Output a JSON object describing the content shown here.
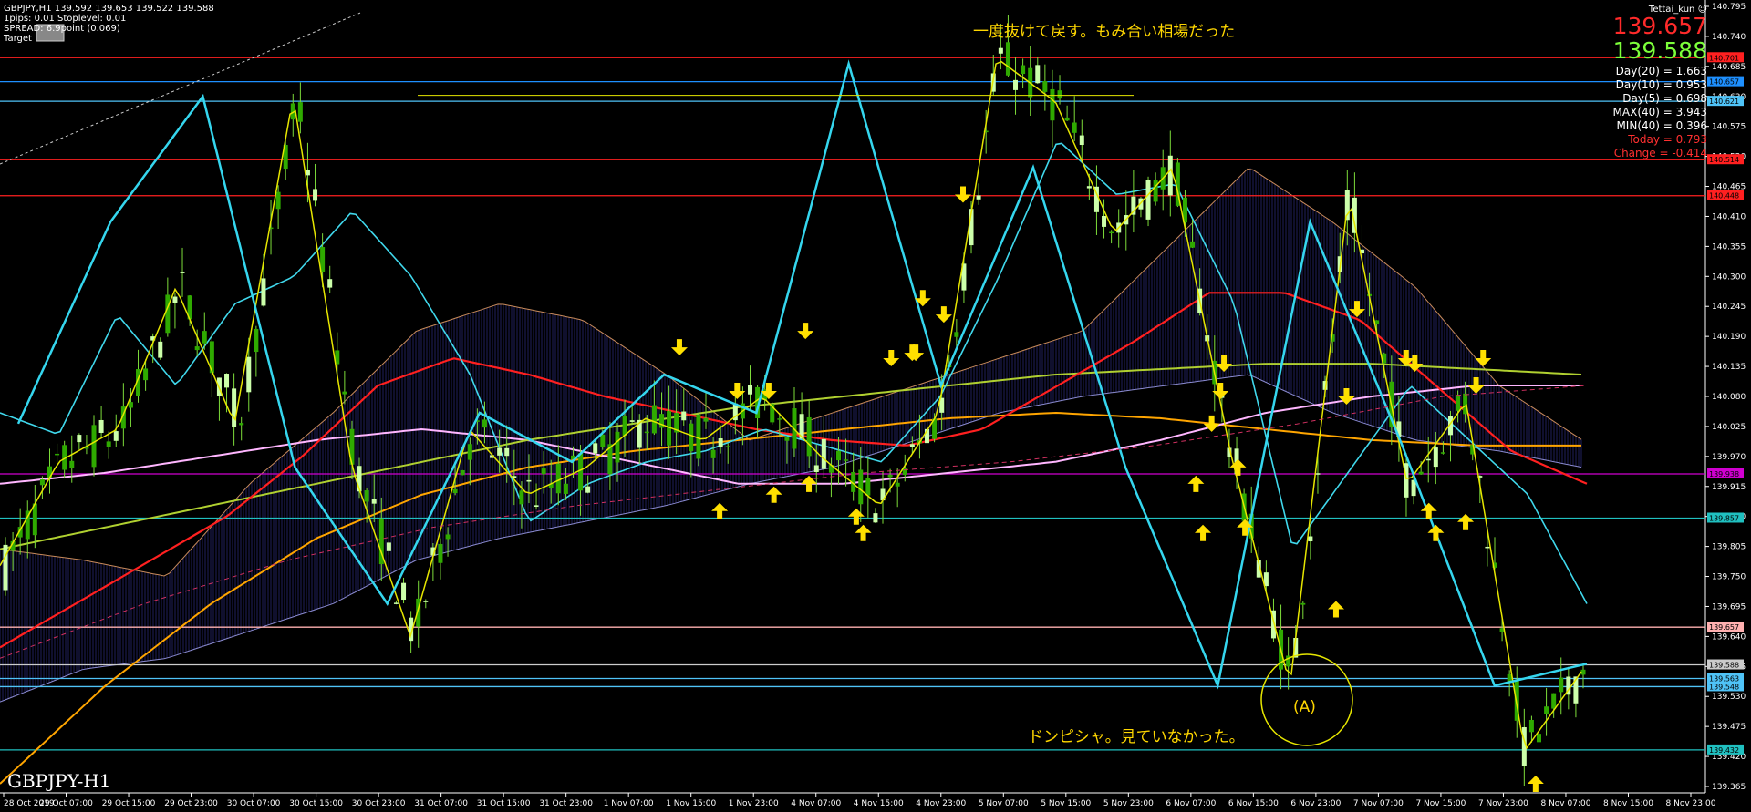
{
  "header": {
    "symbol_line": "GBPJPY,H1  139.592 139.653 139.522 139.588",
    "info_lines": [
      "1pips: 0.01  Stoplevel: 0.01",
      "SPREAD: 6.9point (0.069)",
      "Target"
    ]
  },
  "top_right": {
    "user": "Tettai_kun",
    "smile": "☺"
  },
  "prices": {
    "ask": "139.657",
    "bid": "139.588",
    "ask_color": "#ff2a2a",
    "bid_color": "#7cff3a"
  },
  "stats": [
    {
      "text": "Day(20) = 1.663",
      "color": "#ffffff"
    },
    {
      "text": "Day(10) = 0.953",
      "color": "#ffffff"
    },
    {
      "text": "Day(5) = 0.698",
      "color": "#ffffff"
    },
    {
      "text": "MAX(40) = 3.943",
      "color": "#ffffff"
    },
    {
      "text": "MIN(40) = 0.396",
      "color": "#ffffff"
    },
    {
      "text": "Today = 0.793",
      "color": "#ff3030"
    },
    {
      "text": "Change = -0.414",
      "color": "#ff3030"
    }
  ],
  "annotations": {
    "top": "一度抜けて戻す。もみ合い相場だった",
    "bottom": "ドンピシャ。見ていなかった。",
    "circle_label": "(A)"
  },
  "watermark": "GBPJPY-H1",
  "chart_data": {
    "type": "candlestick",
    "symbol": "GBPJPY",
    "timeframe": "H1",
    "ylim": [
      139.365,
      140.795
    ],
    "y_ticks": [
      "140.795",
      "140.740",
      "140.685",
      "140.630",
      "140.575",
      "140.520",
      "140.465",
      "140.410",
      "140.355",
      "140.300",
      "140.245",
      "140.190",
      "140.135",
      "140.080",
      "140.025",
      "139.970",
      "139.915",
      "139.860",
      "139.805",
      "139.750",
      "139.695",
      "139.640",
      "139.585",
      "139.530",
      "139.475",
      "139.420",
      "139.365"
    ],
    "x_labels": [
      "28 Oct 2019",
      "29 Oct 07:00",
      "29 Oct 15:00",
      "29 Oct 23:00",
      "30 Oct 07:00",
      "30 Oct 15:00",
      "30 Oct 23:00",
      "31 Oct 07:00",
      "31 Oct 15:00",
      "31 Oct 23:00",
      "1 Nov 07:00",
      "1 Nov 15:00",
      "1 Nov 23:00",
      "4 Nov 07:00",
      "4 Nov 15:00",
      "4 Nov 23:00",
      "5 Nov 07:00",
      "5 Nov 15:00",
      "5 Nov 23:00",
      "6 Nov 07:00",
      "6 Nov 15:00",
      "6 Nov 23:00",
      "7 Nov 07:00",
      "7 Nov 15:00",
      "7 Nov 23:00",
      "8 Nov 07:00",
      "8 Nov 15:00",
      "8 Nov 23:00"
    ],
    "h_lines": [
      {
        "price": 140.701,
        "label": "140.701",
        "color": "#ff2020"
      },
      {
        "price": 140.657,
        "label": "140.657",
        "color": "#1e90ff"
      },
      {
        "price": 140.621,
        "label": "140.621",
        "color": "#4fc3f7"
      },
      {
        "price": 140.514,
        "label": "140.514",
        "color": "#ff2020"
      },
      {
        "price": 140.448,
        "label": "140.448",
        "color": "#ff2020"
      },
      {
        "price": 139.938,
        "label": "139.938",
        "color": "#d000d0"
      },
      {
        "price": 139.857,
        "label": "139.857",
        "color": "#20c0c0"
      },
      {
        "price": 139.657,
        "label": "139.657",
        "color": "#ffb0b0"
      },
      {
        "price": 139.588,
        "label": "139.588",
        "color": "#cccccc"
      },
      {
        "price": 139.563,
        "label": "139.563",
        "color": "#4fc3f7"
      },
      {
        "price": 139.548,
        "label": "139.548",
        "color": "#4fc3f7"
      },
      {
        "price": 139.432,
        "label": "139.432",
        "color": "#20c0c0"
      }
    ],
    "swing_points": [
      139.77,
      139.96,
      140.02,
      140.28,
      140.03,
      140.63,
      139.95,
      139.64,
      140.02,
      139.9,
      139.95,
      140.04,
      140.0,
      140.08,
      139.97,
      139.88,
      140.05,
      140.7,
      140.62,
      140.38,
      140.5,
      139.97,
      139.55,
      140.45,
      139.92,
      140.07,
      139.43,
      139.58
    ],
    "upper_mid_swings": [
      140.03,
      140.4,
      140.63,
      139.95,
      139.7,
      140.05,
      139.96,
      140.12,
      140.05,
      140.69,
      140.1,
      140.5,
      139.95,
      139.55,
      140.4,
      139.99,
      139.55,
      139.59
    ],
    "ma_fast": [
      140.05,
      140.01,
      140.23,
      140.1,
      140.25,
      140.3,
      140.42,
      140.3,
      140.12,
      139.85,
      139.92,
      139.96,
      139.98,
      140.02,
      139.99,
      139.96,
      140.08,
      140.3,
      140.55,
      140.45,
      140.47,
      140.25,
      139.8,
      139.95,
      140.1,
      140.0,
      139.9,
      139.7
    ],
    "ma_red": [
      139.62,
      139.7,
      139.78,
      139.86,
      139.97,
      140.1,
      140.15,
      140.12,
      140.08,
      140.05,
      140.02,
      140.0,
      139.99,
      140.02,
      140.1,
      140.18,
      140.27,
      140.27,
      140.22,
      140.1,
      139.98,
      139.92
    ],
    "ma_yellow_green": [
      139.8,
      139.84,
      139.88,
      139.92,
      139.96,
      140.0,
      140.03,
      140.06,
      140.08,
      140.1,
      140.12,
      140.13,
      140.14,
      140.14,
      140.13,
      140.12
    ],
    "ma_orange": [
      139.37,
      139.55,
      139.7,
      139.82,
      139.9,
      139.95,
      139.98,
      140.0,
      140.02,
      140.04,
      140.05,
      140.04,
      140.02,
      140.0,
      139.99,
      139.99
    ],
    "ma_pink": [
      139.92,
      139.94,
      139.97,
      140.0,
      140.02,
      140.0,
      139.96,
      139.92,
      139.92,
      139.94,
      139.96,
      140.0,
      140.05,
      140.08,
      140.1,
      140.1
    ],
    "cloud_top": [
      139.8,
      139.78,
      139.75,
      139.92,
      140.05,
      140.2,
      140.25,
      140.22,
      140.12,
      140.0,
      140.05,
      140.1,
      140.15,
      140.2,
      140.35,
      140.5,
      140.4,
      140.28,
      140.1,
      140.0
    ],
    "cloud_bottom": [
      139.52,
      139.58,
      139.6,
      139.65,
      139.7,
      139.78,
      139.82,
      139.85,
      139.88,
      139.92,
      139.95,
      140.0,
      140.05,
      140.08,
      140.1,
      140.12,
      140.05,
      140.0,
      139.98,
      139.95
    ],
    "arrows_up": [
      {
        "price": 139.9,
        "col": 0.411
      },
      {
        "price": 139.93,
        "col": 0.442
      },
      {
        "price": 139.95,
        "col": 0.462
      },
      {
        "price": 139.89,
        "col": 0.489
      },
      {
        "price": 139.86,
        "col": 0.493
      },
      {
        "price": 139.95,
        "col": 0.683
      },
      {
        "price": 139.86,
        "col": 0.687
      },
      {
        "price": 139.98,
        "col": 0.707
      },
      {
        "price": 139.87,
        "col": 0.711
      },
      {
        "price": 139.72,
        "col": 0.763
      },
      {
        "price": 139.9,
        "col": 0.816
      },
      {
        "price": 139.86,
        "col": 0.82
      },
      {
        "price": 139.88,
        "col": 0.837
      },
      {
        "price": 139.4,
        "col": 0.877
      }
    ],
    "arrows_down": [
      {
        "price": 140.14,
        "col": 0.388
      },
      {
        "price": 140.06,
        "col": 0.421
      },
      {
        "price": 140.06,
        "col": 0.439
      },
      {
        "price": 140.17,
        "col": 0.46
      },
      {
        "price": 140.12,
        "col": 0.509
      },
      {
        "price": 140.13,
        "col": 0.521
      },
      {
        "price": 140.13,
        "col": 0.523
      },
      {
        "price": 140.23,
        "col": 0.527
      },
      {
        "price": 140.2,
        "col": 0.539
      },
      {
        "price": 140.42,
        "col": 0.55
      },
      {
        "price": 140.0,
        "col": 0.692
      },
      {
        "price": 140.06,
        "col": 0.697
      },
      {
        "price": 140.11,
        "col": 0.699
      },
      {
        "price": 140.05,
        "col": 0.769
      },
      {
        "price": 140.21,
        "col": 0.775
      },
      {
        "price": 140.12,
        "col": 0.803
      },
      {
        "price": 140.11,
        "col": 0.808
      },
      {
        "price": 140.07,
        "col": 0.843
      },
      {
        "price": 140.12,
        "col": 0.847
      }
    ],
    "grid": false,
    "colors": {
      "bull": "#ccffaa",
      "bear": "#2faa00",
      "wick": "#7ddc3a",
      "axis": "#ffffff",
      "swing": "#35d6ee",
      "fast": "#e6e600",
      "arrow": "#ffe000"
    }
  }
}
